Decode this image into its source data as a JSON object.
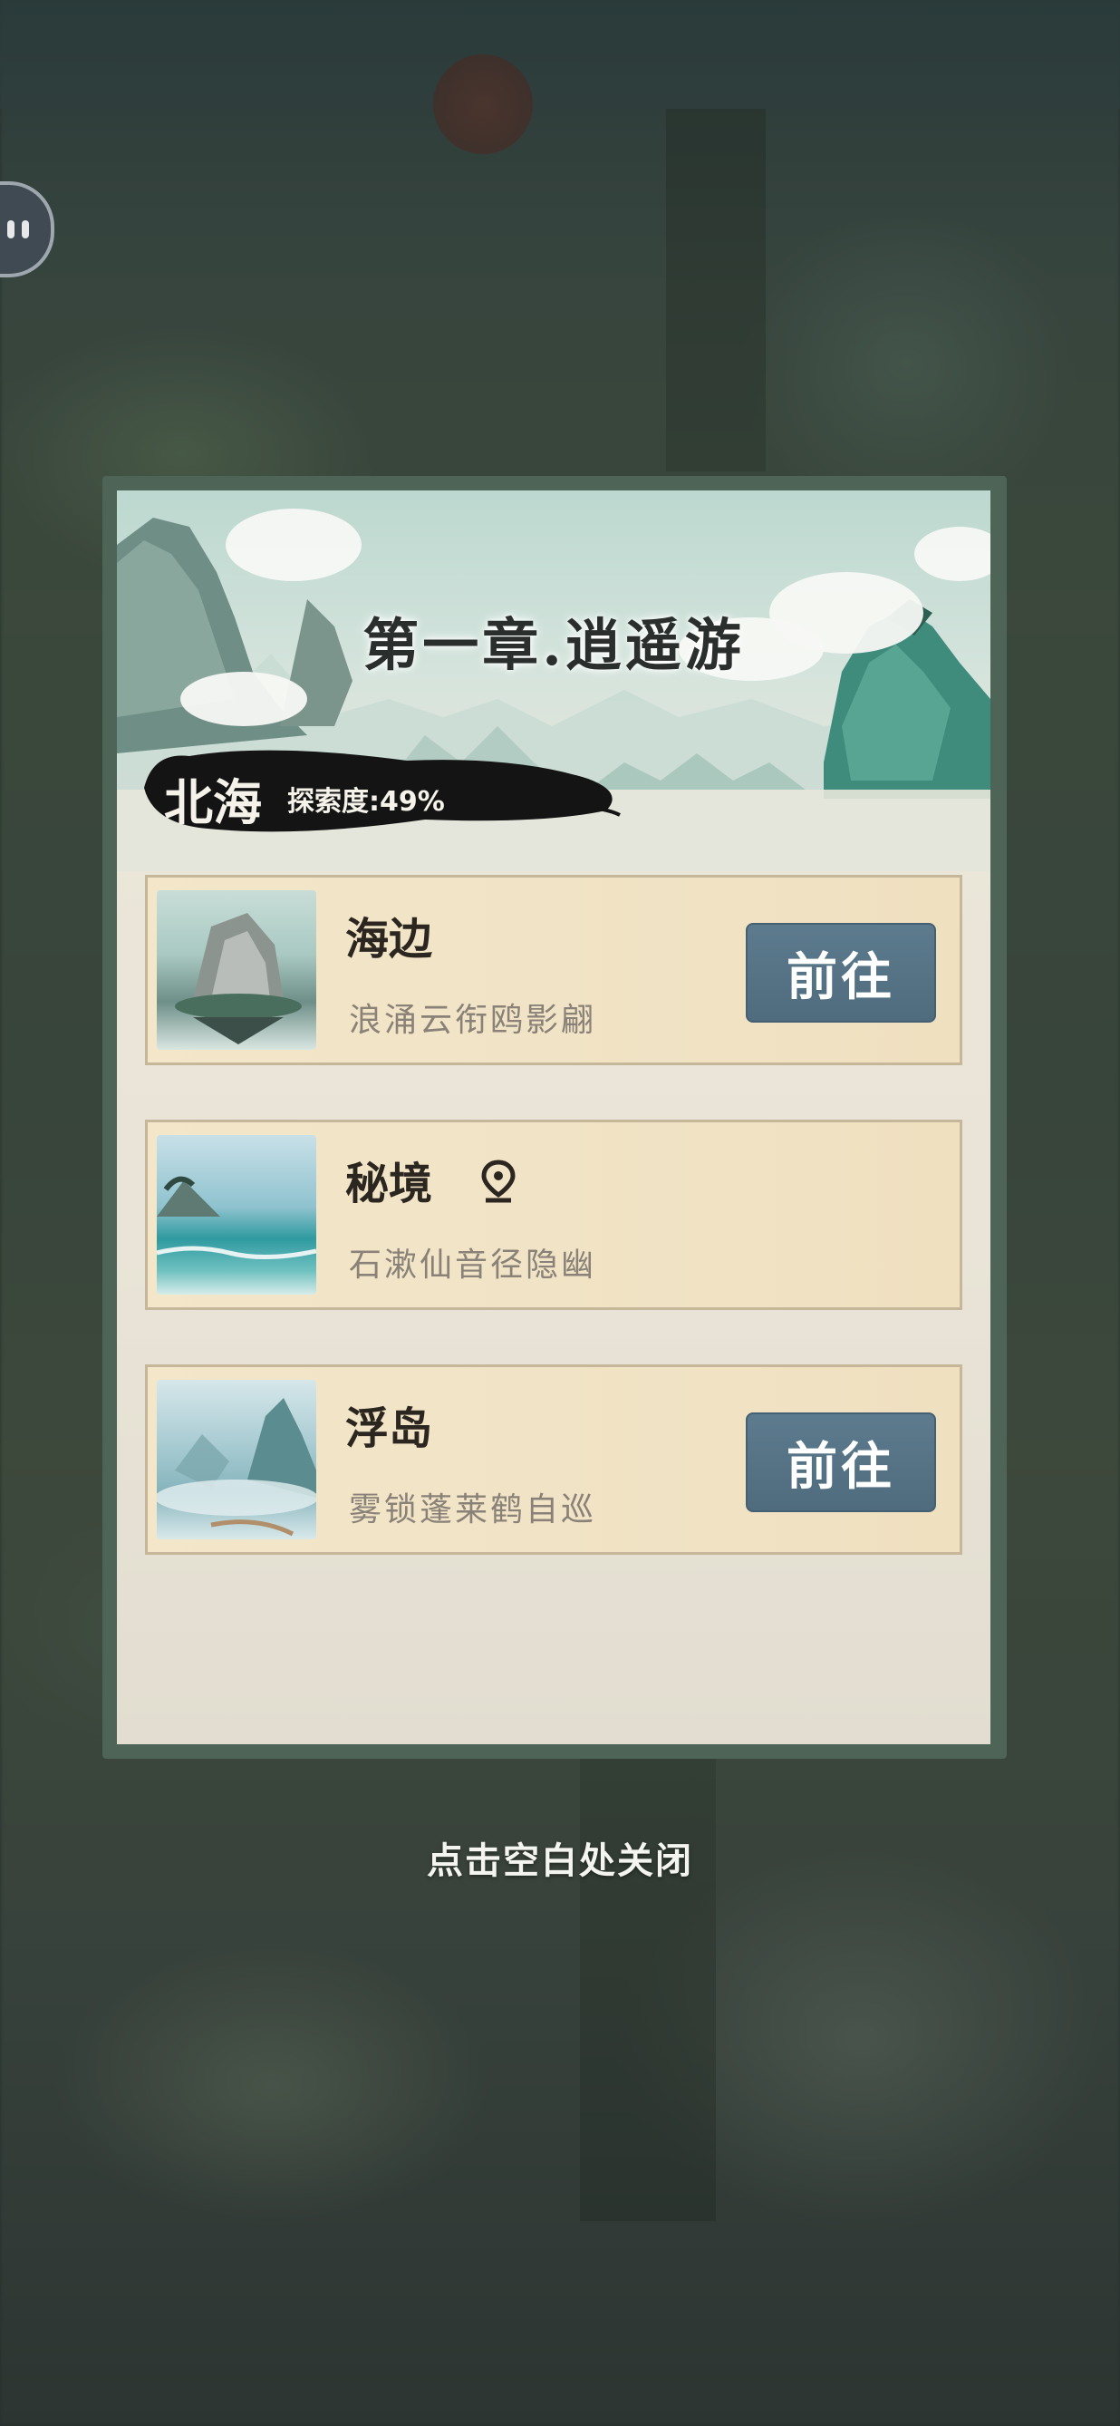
{
  "chapter": {
    "title": "第一章.逍遥游",
    "region": "北海",
    "explore_text": "探索度:49%",
    "explore_progress": 0.49
  },
  "locations": [
    {
      "name": "海边",
      "subtitle": "浪涌云衔鸥影翩",
      "button": "前往",
      "has_pin": false
    },
    {
      "name": "秘境",
      "subtitle": "石漱仙音径隐幽",
      "button": "",
      "has_pin": true
    },
    {
      "name": "浮岛",
      "subtitle": "雾锁蓬莱鹤自巡",
      "button": "前往",
      "has_pin": false
    }
  ],
  "close_hint": "点击空白处关闭",
  "colors": {
    "panel_frame": "#4d6457",
    "go_button": "#587689",
    "card_bg": "#f2e4c6"
  },
  "icons": {
    "side_button": "chat-face-icon",
    "pin": "location-pin-icon"
  }
}
